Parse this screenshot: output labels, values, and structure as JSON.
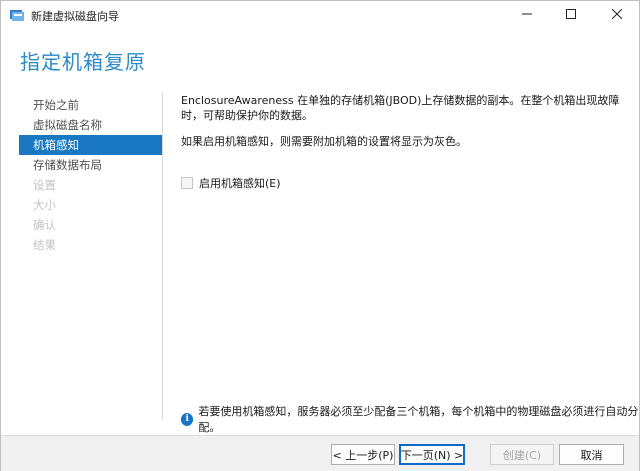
{
  "window": {
    "title": "新建虚拟磁盘向导",
    "controls": [
      "minimize-icon",
      "maximize-icon",
      "close-icon"
    ]
  },
  "header": {
    "title": "指定机箱复原"
  },
  "nav": {
    "items": [
      {
        "label": "开始之前",
        "state": "normal"
      },
      {
        "label": "虚拟磁盘名称",
        "state": "normal"
      },
      {
        "label": "机箱感知",
        "state": "active"
      },
      {
        "label": "存储数据布局",
        "state": "normal"
      },
      {
        "label": "设置",
        "state": "disabled"
      },
      {
        "label": "大小",
        "state": "disabled"
      },
      {
        "label": "确认",
        "state": "disabled"
      },
      {
        "label": "结果",
        "state": "disabled"
      }
    ]
  },
  "main": {
    "description": "EnclosureAwareness 在单独的存储机箱(JBOD)上存储数据的副本。在整个机箱出现故障时，可帮助保护你的数据。",
    "note": "如果启用机箱感知，则需要附加机箱的设置将显示为灰色。",
    "checkbox_label": "启用机箱感知(E)",
    "checkbox_checked": false,
    "info": "若要使用机箱感知，服务器必须至少配备三个机箱，每个机箱中的物理磁盘必须进行自动分配。"
  },
  "footer": {
    "prev_label": "< 上一步(P)",
    "next_label": "下一页(N) >",
    "create_label": "创建(C)",
    "cancel_label": "取消"
  },
  "colors": {
    "accent": "#1a78c2",
    "title_blue": "#2a8ac8"
  }
}
